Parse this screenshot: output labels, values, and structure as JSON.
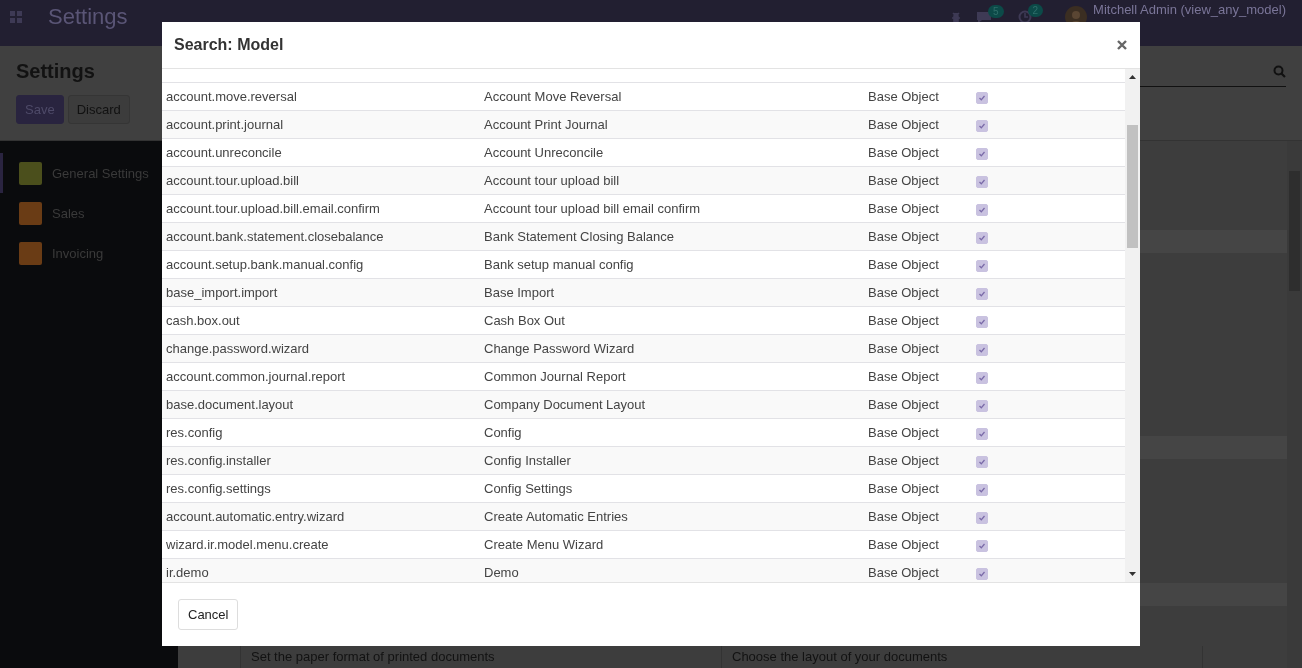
{
  "navbar": {
    "app_title": "Settings",
    "chat_count": "5",
    "activity_count": "2",
    "user": "Mitchell Admin (view_any_model)"
  },
  "control_panel": {
    "title": "Settings",
    "buttons": [
      {
        "label": "Save",
        "kind": "primary"
      },
      {
        "label": "Discard",
        "kind": "secondary"
      }
    ]
  },
  "sidebar": {
    "items": [
      {
        "label": "General Settings",
        "selected": true,
        "color": "#4b4f1c"
      },
      {
        "label": "Sales",
        "selected": false,
        "color": "#6a3c15"
      },
      {
        "label": "Invoicing",
        "selected": false,
        "color": "#6a3c15"
      }
    ]
  },
  "settings_content": {
    "descriptions": [
      "Set the paper format of printed documents",
      "Choose the layout of your documents"
    ]
  },
  "dialog": {
    "title": "Search: Model",
    "rows": [
      {
        "model": "account.move.reversal",
        "name": "Account Move Reversal",
        "type": "Base Object",
        "transient": true
      },
      {
        "model": "account.print.journal",
        "name": "Account Print Journal",
        "type": "Base Object",
        "transient": true
      },
      {
        "model": "account.unreconcile",
        "name": "Account Unreconcile",
        "type": "Base Object",
        "transient": true
      },
      {
        "model": "account.tour.upload.bill",
        "name": "Account tour upload bill",
        "type": "Base Object",
        "transient": true
      },
      {
        "model": "account.tour.upload.bill.email.confirm",
        "name": "Account tour upload bill email confirm",
        "type": "Base Object",
        "transient": true
      },
      {
        "model": "account.bank.statement.closebalance",
        "name": "Bank Statement Closing Balance",
        "type": "Base Object",
        "transient": true
      },
      {
        "model": "account.setup.bank.manual.config",
        "name": "Bank setup manual config",
        "type": "Base Object",
        "transient": true
      },
      {
        "model": "base_import.import",
        "name": "Base Import",
        "type": "Base Object",
        "transient": true
      },
      {
        "model": "cash.box.out",
        "name": "Cash Box Out",
        "type": "Base Object",
        "transient": true
      },
      {
        "model": "change.password.wizard",
        "name": "Change Password Wizard",
        "type": "Base Object",
        "transient": true
      },
      {
        "model": "account.common.journal.report",
        "name": "Common Journal Report",
        "type": "Base Object",
        "transient": true
      },
      {
        "model": "base.document.layout",
        "name": "Company Document Layout",
        "type": "Base Object",
        "transient": true
      },
      {
        "model": "res.config",
        "name": "Config",
        "type": "Base Object",
        "transient": true
      },
      {
        "model": "res.config.installer",
        "name": "Config Installer",
        "type": "Base Object",
        "transient": true
      },
      {
        "model": "res.config.settings",
        "name": "Config Settings",
        "type": "Base Object",
        "transient": true
      },
      {
        "model": "account.automatic.entry.wizard",
        "name": "Create Automatic Entries",
        "type": "Base Object",
        "transient": true
      },
      {
        "model": "wizard.ir.model.menu.create",
        "name": "Create Menu Wizard",
        "type": "Base Object",
        "transient": true
      },
      {
        "model": "ir.demo",
        "name": "Demo",
        "type": "Base Object",
        "transient": true
      }
    ],
    "buttons": [
      "Cancel"
    ]
  }
}
